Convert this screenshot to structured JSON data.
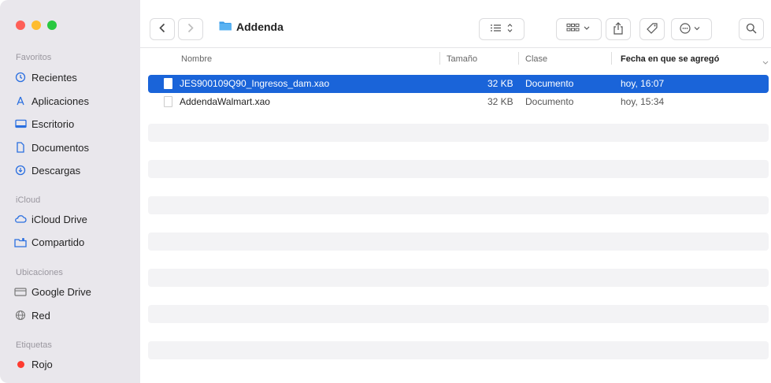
{
  "window": {
    "title": "Addenda"
  },
  "colors": {
    "accent": "#1a64d9",
    "close": "#fe5f57",
    "minimize": "#febc2e",
    "zoom": "#28c840",
    "tag_red": "#fe3b30"
  },
  "sidebar": {
    "favoritos": {
      "title": "Favoritos",
      "items": [
        "Recientes",
        "Aplicaciones",
        "Escritorio",
        "Documentos",
        "Descargas"
      ]
    },
    "icloud": {
      "title": "iCloud",
      "items": [
        "iCloud Drive",
        "Compartido"
      ]
    },
    "ubicaciones": {
      "title": "Ubicaciones",
      "items": [
        "Google Drive",
        "Red"
      ]
    },
    "etiquetas": {
      "title": "Etiquetas",
      "items": [
        "Rojo"
      ]
    }
  },
  "columns": {
    "name": "Nombre",
    "size": "Tamaño",
    "kind": "Clase",
    "date": "Fecha en que se agregó"
  },
  "files": [
    {
      "name": "JES900109Q90_Ingresos_dam.xao",
      "size": "32 KB",
      "kind": "Documento",
      "date": "hoy, 16:07",
      "selected": true
    },
    {
      "name": "AddendaWalmart.xao",
      "size": "32 KB",
      "kind": "Documento",
      "date": "hoy, 15:34",
      "selected": false
    }
  ]
}
